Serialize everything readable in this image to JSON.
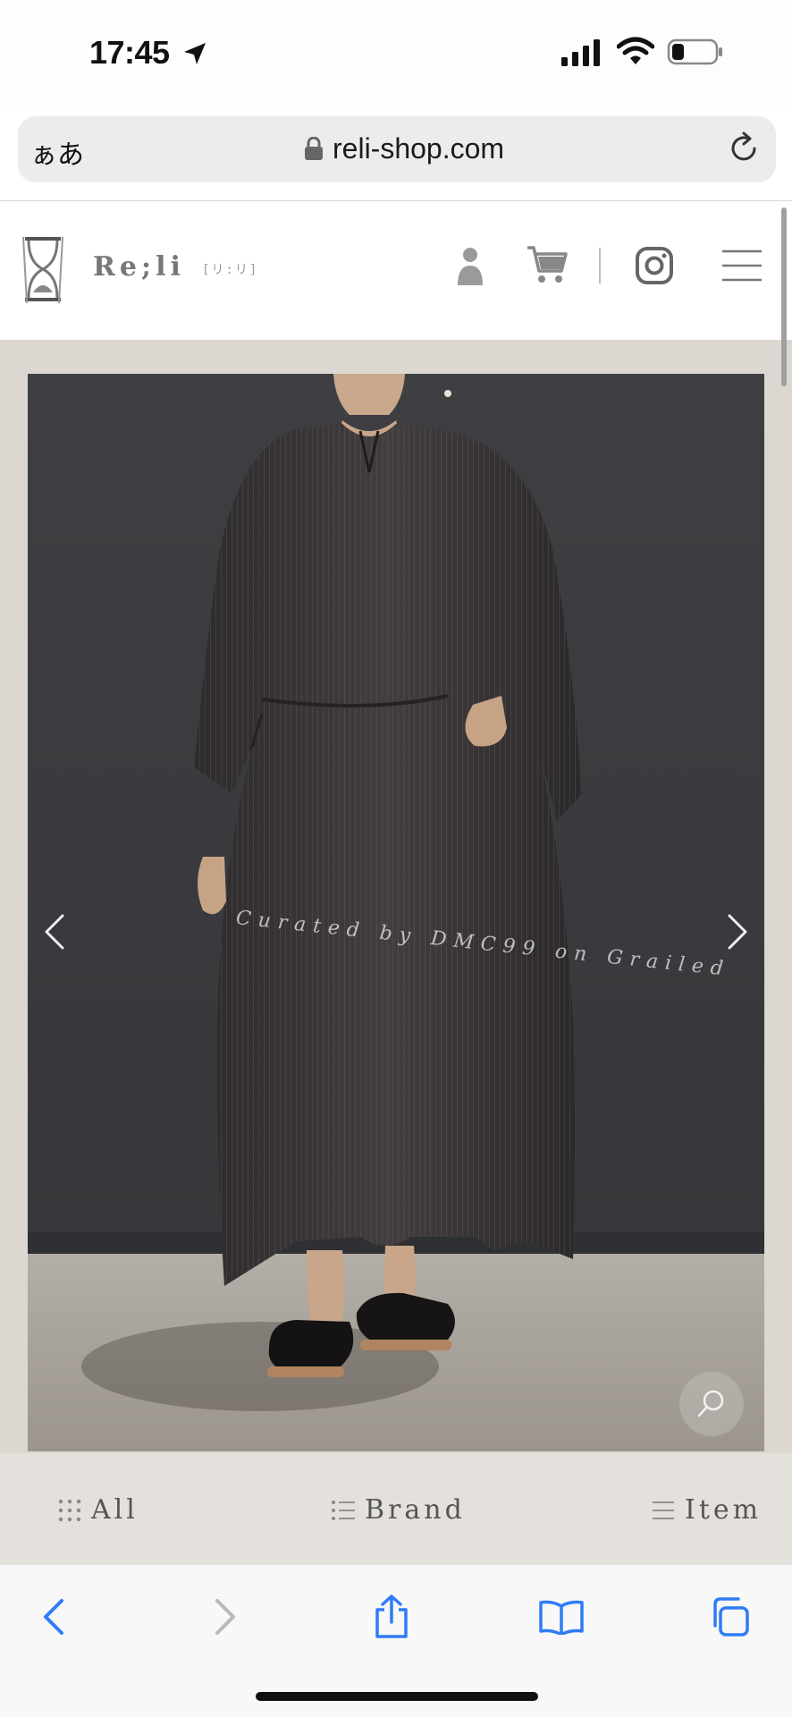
{
  "status_bar": {
    "time": "17:45"
  },
  "browser": {
    "text_size_label": "ぁあ",
    "domain": "reli-shop.com"
  },
  "site": {
    "logo_text": "Re;li",
    "logo_sub": "[リ:リ]"
  },
  "hero": {
    "watermark": "Curated by DMC99 on Grailed"
  },
  "categories": [
    {
      "label": "All",
      "icon": "grid-icon"
    },
    {
      "label": "Brand",
      "icon": "list-icon"
    },
    {
      "label": "Item",
      "icon": "menu-lines-icon"
    }
  ],
  "colors": {
    "header_bg": "#ffffff",
    "hero_frame": "#dcd7d1",
    "category_bar": "#e4e0db",
    "ios_blue": "#2f7cf6",
    "wall": "#3b3c3f",
    "garment": "#3a3637"
  }
}
